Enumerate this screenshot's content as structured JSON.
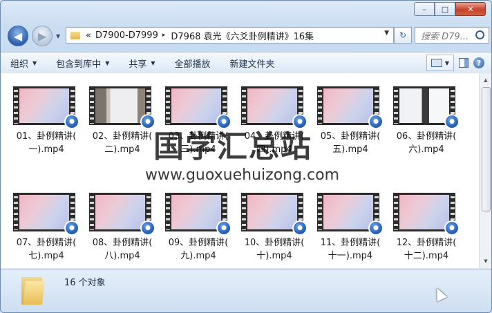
{
  "window": {
    "controls": {
      "minimize": "–",
      "maximize": "□",
      "close": "✕"
    }
  },
  "nav": {
    "back_icon": "◀",
    "forward_icon": "▶",
    "address": {
      "prefix": "«",
      "segments": [
        "D7900-D7999",
        "D7968 袁光《六爻卦例精讲》16集"
      ],
      "separator": "▸"
    },
    "refresh_icon": "↻",
    "search_placeholder": "搜索 D79..."
  },
  "toolbar": {
    "organize": "组织",
    "include_in_library": "包含到库中",
    "share": "共享",
    "play_all": "全部播放",
    "new_folder": "新建文件夹"
  },
  "files": [
    {
      "label": "01、卦例精讲(\n一).mp4",
      "thumb": "gradient"
    },
    {
      "label": "02、卦例精讲(\n二).mp4",
      "thumb": "photo1"
    },
    {
      "label": "03、卦例精讲(\n三).mp4",
      "thumb": "gradient"
    },
    {
      "label": "04、卦例精讲(\n四).mp4",
      "thumb": "gradient"
    },
    {
      "label": "05、卦例精讲(\n五).mp4",
      "thumb": "gradient"
    },
    {
      "label": "06、卦例精讲(\n六).mp4",
      "thumb": "photo2"
    },
    {
      "label": "07、卦例精讲(\n七).mp4",
      "thumb": "gradient"
    },
    {
      "label": "08、卦例精讲(\n八).mp4",
      "thumb": "gradient"
    },
    {
      "label": "09、卦例精讲(\n九).mp4",
      "thumb": "gradient"
    },
    {
      "label": "10、卦例精讲(\n十).mp4",
      "thumb": "gradient"
    },
    {
      "label": "11、卦例精讲(\n十一).mp4",
      "thumb": "gradient"
    },
    {
      "label": "12、卦例精讲(\n十二).mp4",
      "thumb": "gradient"
    }
  ],
  "watermark": {
    "line1": "国学汇总站",
    "line2": "www.guoxuehuizong.com"
  },
  "status": {
    "count_text": "16 个对象"
  },
  "colors": {
    "accent": "#2a5fae",
    "play_badge": "#1f58b4",
    "close_button": "#c7412a"
  }
}
